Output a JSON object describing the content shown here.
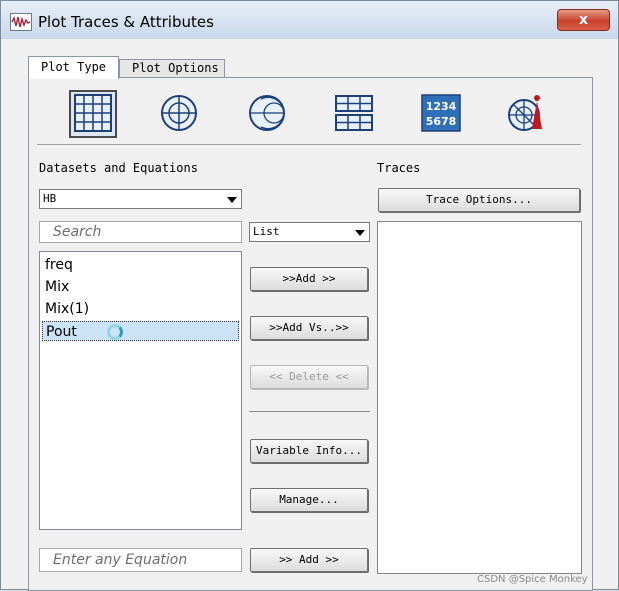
{
  "window": {
    "title": "Plot Traces & Attributes",
    "close_label": "x"
  },
  "tabs": [
    {
      "label": "Plot Type",
      "active": true
    },
    {
      "label": "Plot Options",
      "active": false
    }
  ],
  "plot_types": [
    {
      "name": "rectangular-plot-icon",
      "selected": true
    },
    {
      "name": "polar-plot-icon",
      "selected": false
    },
    {
      "name": "smith-chart-icon",
      "selected": false
    },
    {
      "name": "stacked-rectangular-icon",
      "selected": false
    },
    {
      "name": "list-view-icon",
      "label": "1234\n5678",
      "selected": false
    },
    {
      "name": "antenna-plot-icon",
      "selected": false
    }
  ],
  "datasets": {
    "heading": "Datasets and Equations",
    "dataset_value": "HB",
    "search_placeholder": "Search",
    "view_mode": "List",
    "items": [
      "freq",
      "Mix",
      "Mix(1)",
      "Pout"
    ],
    "selected_item": "Pout",
    "equation_placeholder": "Enter any Equation"
  },
  "actions": {
    "add": ">>Add >>",
    "add_vs": ">>Add Vs..>>",
    "delete": "<< Delete <<",
    "variable_info": "Variable Info...",
    "manage": "Manage...",
    "add_equation": ">> Add >>"
  },
  "traces": {
    "heading": "Traces",
    "trace_options": "Trace Options..."
  },
  "watermark": "CSDN @Spice Monkey"
}
